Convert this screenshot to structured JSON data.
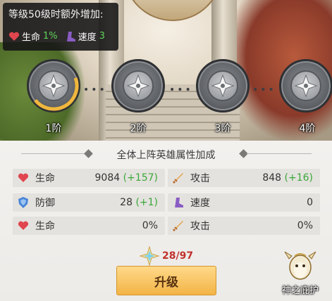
{
  "tooltip": {
    "title": "等级50级时额外增加:",
    "hp_label": "生命",
    "hp_value": "1%",
    "speed_label": "速度",
    "speed_value": "3"
  },
  "tiers": [
    {
      "label": "1阶",
      "progress": 0.45
    },
    {
      "label": "2阶",
      "progress": 0
    },
    {
      "label": "3阶",
      "progress": 0
    },
    {
      "label": "4阶",
      "progress": 0
    }
  ],
  "panel": {
    "title": "全体上阵英雄属性加成",
    "stats": [
      {
        "name": "生命",
        "value": "9084",
        "bonus": "(+157)",
        "icon": "heart-icon"
      },
      {
        "name": "攻击",
        "value": "848",
        "bonus": "(+16)",
        "icon": "sword-icon"
      },
      {
        "name": "防御",
        "value": "28",
        "bonus": "(+1)",
        "icon": "shield-icon"
      },
      {
        "name": "速度",
        "value": "0",
        "bonus": "",
        "icon": "boot-icon"
      },
      {
        "name": "生命",
        "value": "0%",
        "bonus": "",
        "icon": "heart-icon"
      },
      {
        "name": "攻击",
        "value": "0%",
        "bonus": "",
        "icon": "sword-icon"
      }
    ],
    "cost": "28/97",
    "upgrade_label": "升级",
    "guardian_label": "神之庇护"
  },
  "colors": {
    "bonus_green": "#3aa83a",
    "cost_red": "#c0312b",
    "button_gold": "#f2b446",
    "progress_gold": "#f0b73c"
  }
}
